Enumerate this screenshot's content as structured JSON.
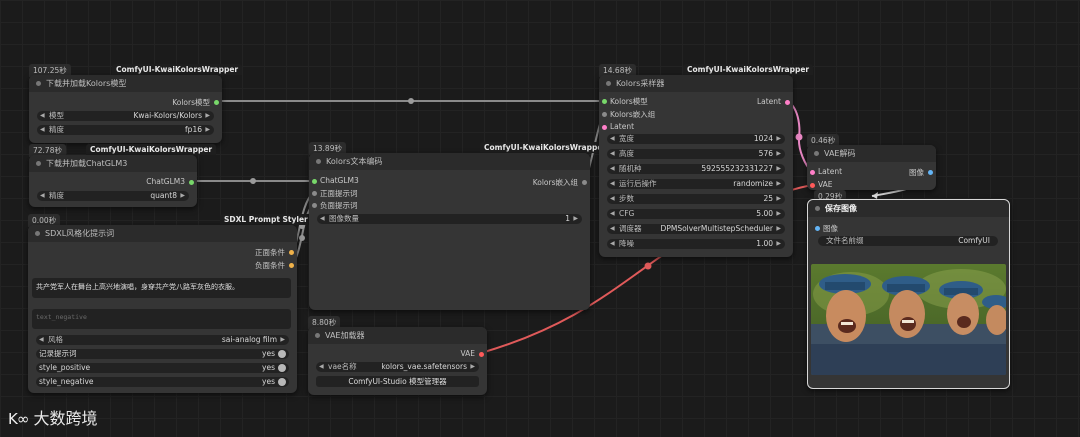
{
  "accent_colors": {
    "model_pin": "#78d86a",
    "latent_pin": "#ff7fc8",
    "vae_pin": "#ff5a5a",
    "cond_pin": "#f0b24a",
    "image_pin": "#64b5f6",
    "wire_gray": "#8a8a8a",
    "wire_red": "#e05a5a",
    "wire_pink": "#e887c3"
  },
  "node_load_kolors": {
    "time": "107.25秒",
    "source": "ComfyUI-KwaiKolorsWrapper",
    "title": "下载并加载Kolors模型",
    "output": "Kolors模型",
    "widgets": [
      {
        "label": "模型",
        "value": "Kwai-Kolors/Kolors"
      },
      {
        "label": "精度",
        "value": "fp16"
      }
    ]
  },
  "node_load_chatglm": {
    "time": "72.78秒",
    "source": "ComfyUI-KwaiKolorsWrapper",
    "title": "下载并加载ChatGLM3",
    "output": "ChatGLM3",
    "widgets": [
      {
        "label": "精度",
        "value": "quant8"
      }
    ]
  },
  "node_styler": {
    "time": "0.00秒",
    "source": "SDXL Prompt Styler",
    "title": "SDXL风格化提示词",
    "outputs": [
      "正面条件",
      "负面条件"
    ],
    "positive_text": "共产党军人在舞台上高兴地演唱，身穿共产党八路军灰色的衣服。",
    "negative_placeholder": "text_negative",
    "style": {
      "label": "风格",
      "value": "sai-analog film"
    },
    "toggles": [
      {
        "label": "记录提示词",
        "value": "yes"
      },
      {
        "label": "style_positive",
        "value": "yes"
      },
      {
        "label": "style_negative",
        "value": "yes"
      }
    ]
  },
  "node_text_encode": {
    "time": "13.89秒",
    "source": "ComfyUI-KwaiKolorsWrapper",
    "title": "Kolors文本编码",
    "inputs": [
      "ChatGLM3",
      "正面提示词",
      "负面提示词"
    ],
    "output": "Kolors嵌入组",
    "widget": {
      "label": "图像数量",
      "value": "1"
    }
  },
  "node_vae_loader": {
    "time": "8.80秒",
    "title": "VAE加载器",
    "output": "VAE",
    "widget": {
      "label": "vae名称",
      "value": "kolors_vae.safetensors"
    },
    "button": "ComfyUI-Studio 模型管理器"
  },
  "node_sampler": {
    "time": "14.68秒",
    "source": "ComfyUI-KwaiKolorsWrapper",
    "title": "Kolors采样器",
    "inputs": [
      "Kolors模型",
      "Kolors嵌入组",
      "Latent"
    ],
    "output": "Latent",
    "widgets": [
      {
        "label": "宽度",
        "value": "1024"
      },
      {
        "label": "高度",
        "value": "576"
      },
      {
        "label": "随机种",
        "value": "592555232331227"
      },
      {
        "label": "运行后操作",
        "value": "randomize"
      },
      {
        "label": "步数",
        "value": "25"
      },
      {
        "label": "CFG",
        "value": "5.00"
      },
      {
        "label": "调度器",
        "value": "DPMSolverMultistepScheduler"
      },
      {
        "label": "降噪",
        "value": "1.00"
      }
    ]
  },
  "node_vae_decode": {
    "time": "0.46秒",
    "title": "VAE解码",
    "inputs": [
      "Latent",
      "VAE"
    ],
    "output": "图像"
  },
  "node_save_image": {
    "time": "0.29秒",
    "title": "保存图像",
    "input": "图像",
    "widget": {
      "label": "文件名前缀",
      "value": "ComfyUI"
    }
  },
  "watermark": "大数跨境"
}
